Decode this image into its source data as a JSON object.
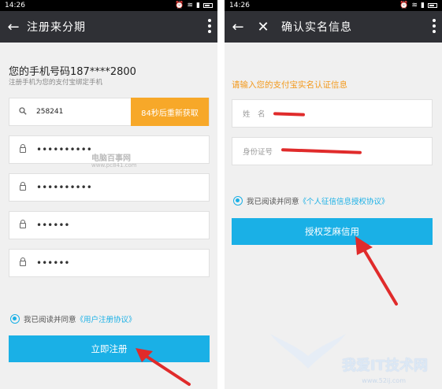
{
  "left": {
    "status_time": "14:26",
    "title": "注册来分期",
    "phone_label": "您的手机号码187****2800",
    "phone_sub": "注册手机为您的支付宝绑定手机",
    "code_value": "258241",
    "resend_label": "84秒后重新获取",
    "password_fields": [
      "••••••••••",
      "••••••••••",
      "••••••",
      "••••••"
    ],
    "watermark": "电脑百事网",
    "watermark_url": "www.pc841.com",
    "agree_text": "我已阅读并同意",
    "agree_link": "《用户注册协议》",
    "register_button": "立即注册"
  },
  "right": {
    "status_time": "14:26",
    "title": "确认实名信息",
    "prompt": "请输入您的支付宝实名认证信息",
    "name_label": "姓　名",
    "id_label": "身份证号",
    "agree_text": "我已阅读并同意",
    "agree_link": "《个人征信信息授权协议》",
    "auth_button": "授权芝麻信用"
  },
  "watermark_site": "我爱IT技术网",
  "watermark_site_url": "www.52ij.com",
  "colors": {
    "accent": "#1ab0e6",
    "orange": "#f7a829",
    "appbar": "#2f3035",
    "arrow": "#e02b2b"
  }
}
